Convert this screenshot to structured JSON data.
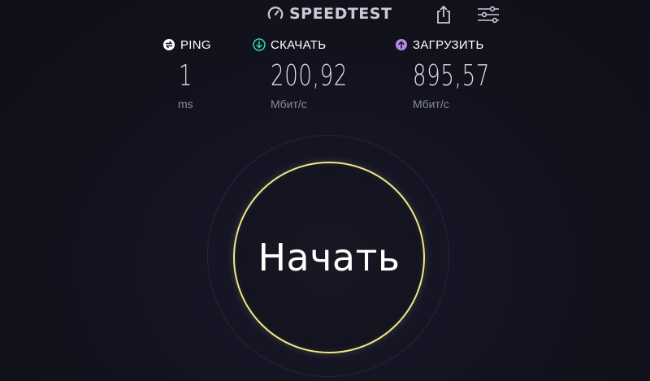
{
  "header": {
    "brand": "SPEEDTEST",
    "icons": {
      "logo": "speedometer-icon",
      "share": "share-icon",
      "settings": "sliders-icon"
    }
  },
  "metrics": {
    "ping": {
      "label": "PING",
      "value": "1",
      "unit": "ms",
      "icon": "ping-icon"
    },
    "download": {
      "label": "СКАЧАТЬ",
      "value": "200,92",
      "unit": "Мбит/с",
      "icon": "download-arrow-icon",
      "color": "#2fd6b6"
    },
    "upload": {
      "label": "ЗАГРУЗИТЬ",
      "value": "895,57",
      "unit": "Мбит/с",
      "icon": "upload-arrow-icon",
      "color": "#b58be6"
    }
  },
  "start_button": {
    "label": "Начать",
    "ring_color": "#efe88c"
  },
  "colors": {
    "background": "#13131f",
    "text": "#ffffff",
    "muted": "#8a8b98"
  }
}
